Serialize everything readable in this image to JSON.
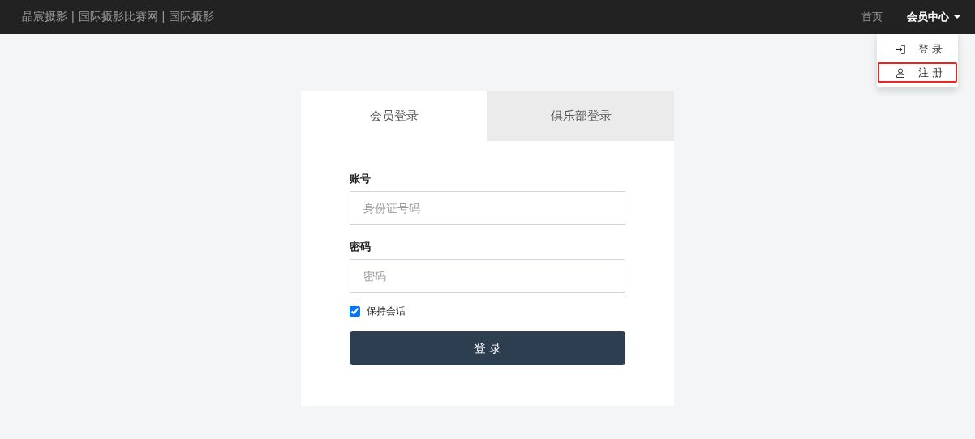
{
  "navbar": {
    "brand": "晶宸摄影 | 国际摄影比赛网 | 国际摄影",
    "links": [
      {
        "label": "首页",
        "kind": "link"
      },
      {
        "label": "会员中心",
        "kind": "dropdown"
      }
    ]
  },
  "dropdown": {
    "items": [
      {
        "label": "登 录",
        "kind": "login",
        "selected": false
      },
      {
        "label": "注 册",
        "kind": "register",
        "selected": true
      }
    ]
  },
  "tabs": [
    {
      "label": "会员登录",
      "selected": true
    },
    {
      "label": "俱乐部登录",
      "selected": false
    }
  ],
  "form": {
    "fields": [
      {
        "label": "账号",
        "placeholder": "身份证号码"
      },
      {
        "label": "密码",
        "placeholder": "密码"
      }
    ],
    "remember": {
      "label": "保持会话",
      "checked": true
    },
    "submit": "登 录"
  }
}
